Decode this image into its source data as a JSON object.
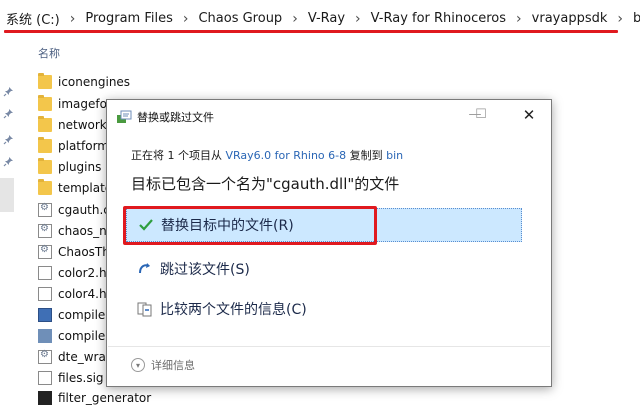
{
  "breadcrumb": {
    "items": [
      "系统 (C:)",
      "Program Files",
      "Chaos Group",
      "V-Ray",
      "V-Ray for Rhinoceros",
      "vrayappsdk",
      "bin"
    ],
    "separator": "›"
  },
  "file_list": {
    "column_header": "名称",
    "files": [
      {
        "name": "iconengines",
        "icon": "folder-icon"
      },
      {
        "name": "imagefo",
        "icon": "folder-icon"
      },
      {
        "name": "network",
        "icon": "folder-icon"
      },
      {
        "name": "platform",
        "icon": "folder-icon"
      },
      {
        "name": "plugins",
        "icon": "folder-icon"
      },
      {
        "name": "template",
        "icon": "folder-icon"
      },
      {
        "name": "cgauth.c",
        "icon": "dll-icon"
      },
      {
        "name": "chaos_n",
        "icon": "dll-icon"
      },
      {
        "name": "ChaosTh",
        "icon": "dll-icon"
      },
      {
        "name": "color2.h",
        "icon": "file-icon"
      },
      {
        "name": "color4.h",
        "icon": "file-icon"
      },
      {
        "name": "compile",
        "icon": "exe-icon"
      },
      {
        "name": "compile",
        "icon": "cube-icon"
      },
      {
        "name": "dte_wra",
        "icon": "dll-icon"
      },
      {
        "name": "files.sig",
        "icon": "file-icon"
      },
      {
        "name": "filter_generator",
        "icon": "image-icon"
      }
    ]
  },
  "dialog": {
    "title": "替换或跳过文件",
    "status_prefix": "正在将 1 个项目从",
    "source": "VRay6.0 for Rhino 6-8",
    "status_middle": "复制到",
    "destination": "bin",
    "headline": "目标已包含一个名为\"cgauth.dll\"的文件",
    "options": {
      "replace": "替换目标中的文件(R)",
      "skip": "跳过该文件(S)",
      "compare": "比较两个文件的信息(C)"
    },
    "details": "详细信息",
    "minimize": "—",
    "maximize": "☐",
    "close": "✕"
  },
  "colors": {
    "highlight": "#e0191f",
    "selection": "#cce8ff",
    "link": "#2a66b5",
    "check": "#2e9e3f"
  }
}
